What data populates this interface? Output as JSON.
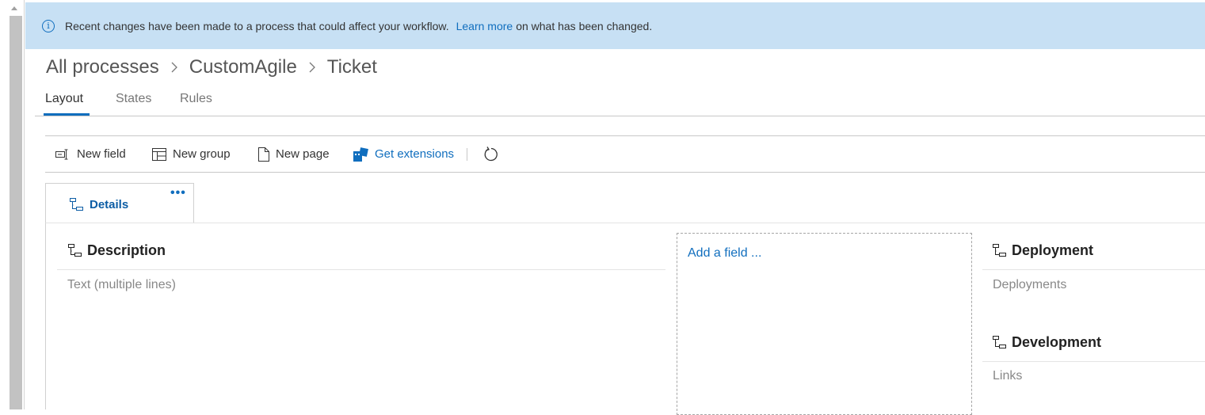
{
  "banner": {
    "icon": "info-icon",
    "message": "Recent changes have been made to a process that could affect your workflow.",
    "link_text": "Learn more",
    "suffix": "on what has been changed."
  },
  "breadcrumb": {
    "items": [
      "All processes",
      "CustomAgile",
      "Ticket"
    ],
    "separator_icon": "chevron-right-icon"
  },
  "tabs": [
    {
      "label": "Layout",
      "active": true
    },
    {
      "label": "States",
      "active": false
    },
    {
      "label": "Rules",
      "active": false
    }
  ],
  "toolbar": {
    "new_field": "New field",
    "new_group": "New group",
    "new_page": "New page",
    "get_extensions": "Get extensions",
    "refresh_icon": "refresh-icon"
  },
  "page": {
    "label": "Details",
    "more_icon": "more-icon"
  },
  "groups": {
    "description": {
      "title": "Description",
      "field": "Text (multiple lines)"
    },
    "deployment": {
      "title": "Deployment",
      "field": "Deployments"
    },
    "development": {
      "title": "Development",
      "field": "Links"
    }
  },
  "dropzone": {
    "label": "Add a field ..."
  },
  "colors": {
    "accent": "#106ebe",
    "banner_bg": "#c7e0f4"
  }
}
